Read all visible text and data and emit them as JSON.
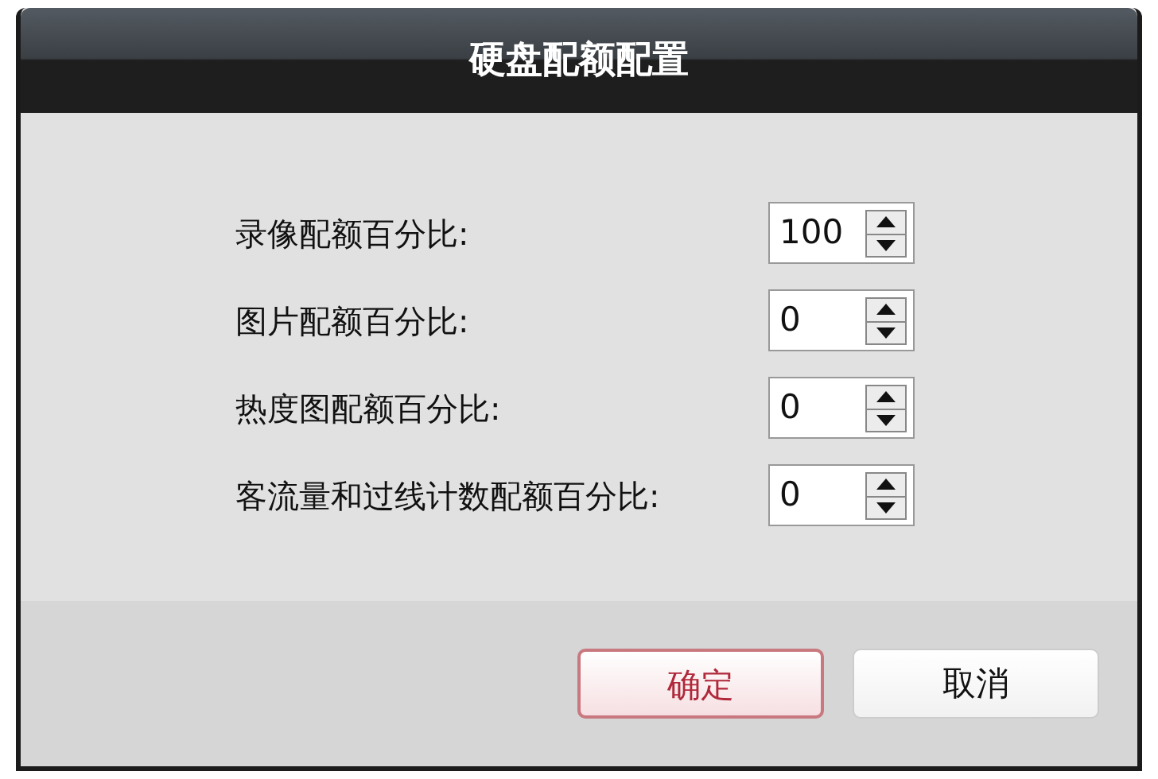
{
  "window": {
    "title": "硬盘配额配置"
  },
  "fields": [
    {
      "label": "录像配额百分比:",
      "value": "100"
    },
    {
      "label": "图片配额百分比:",
      "value": "0"
    },
    {
      "label": "热度图配额百分比:",
      "value": "0"
    },
    {
      "label": "客流量和过线计数配额百分比:",
      "value": "0"
    }
  ],
  "buttons": [
    {
      "label": "确定",
      "kind": "primary"
    },
    {
      "label": "取消",
      "kind": "secondary"
    }
  ]
}
